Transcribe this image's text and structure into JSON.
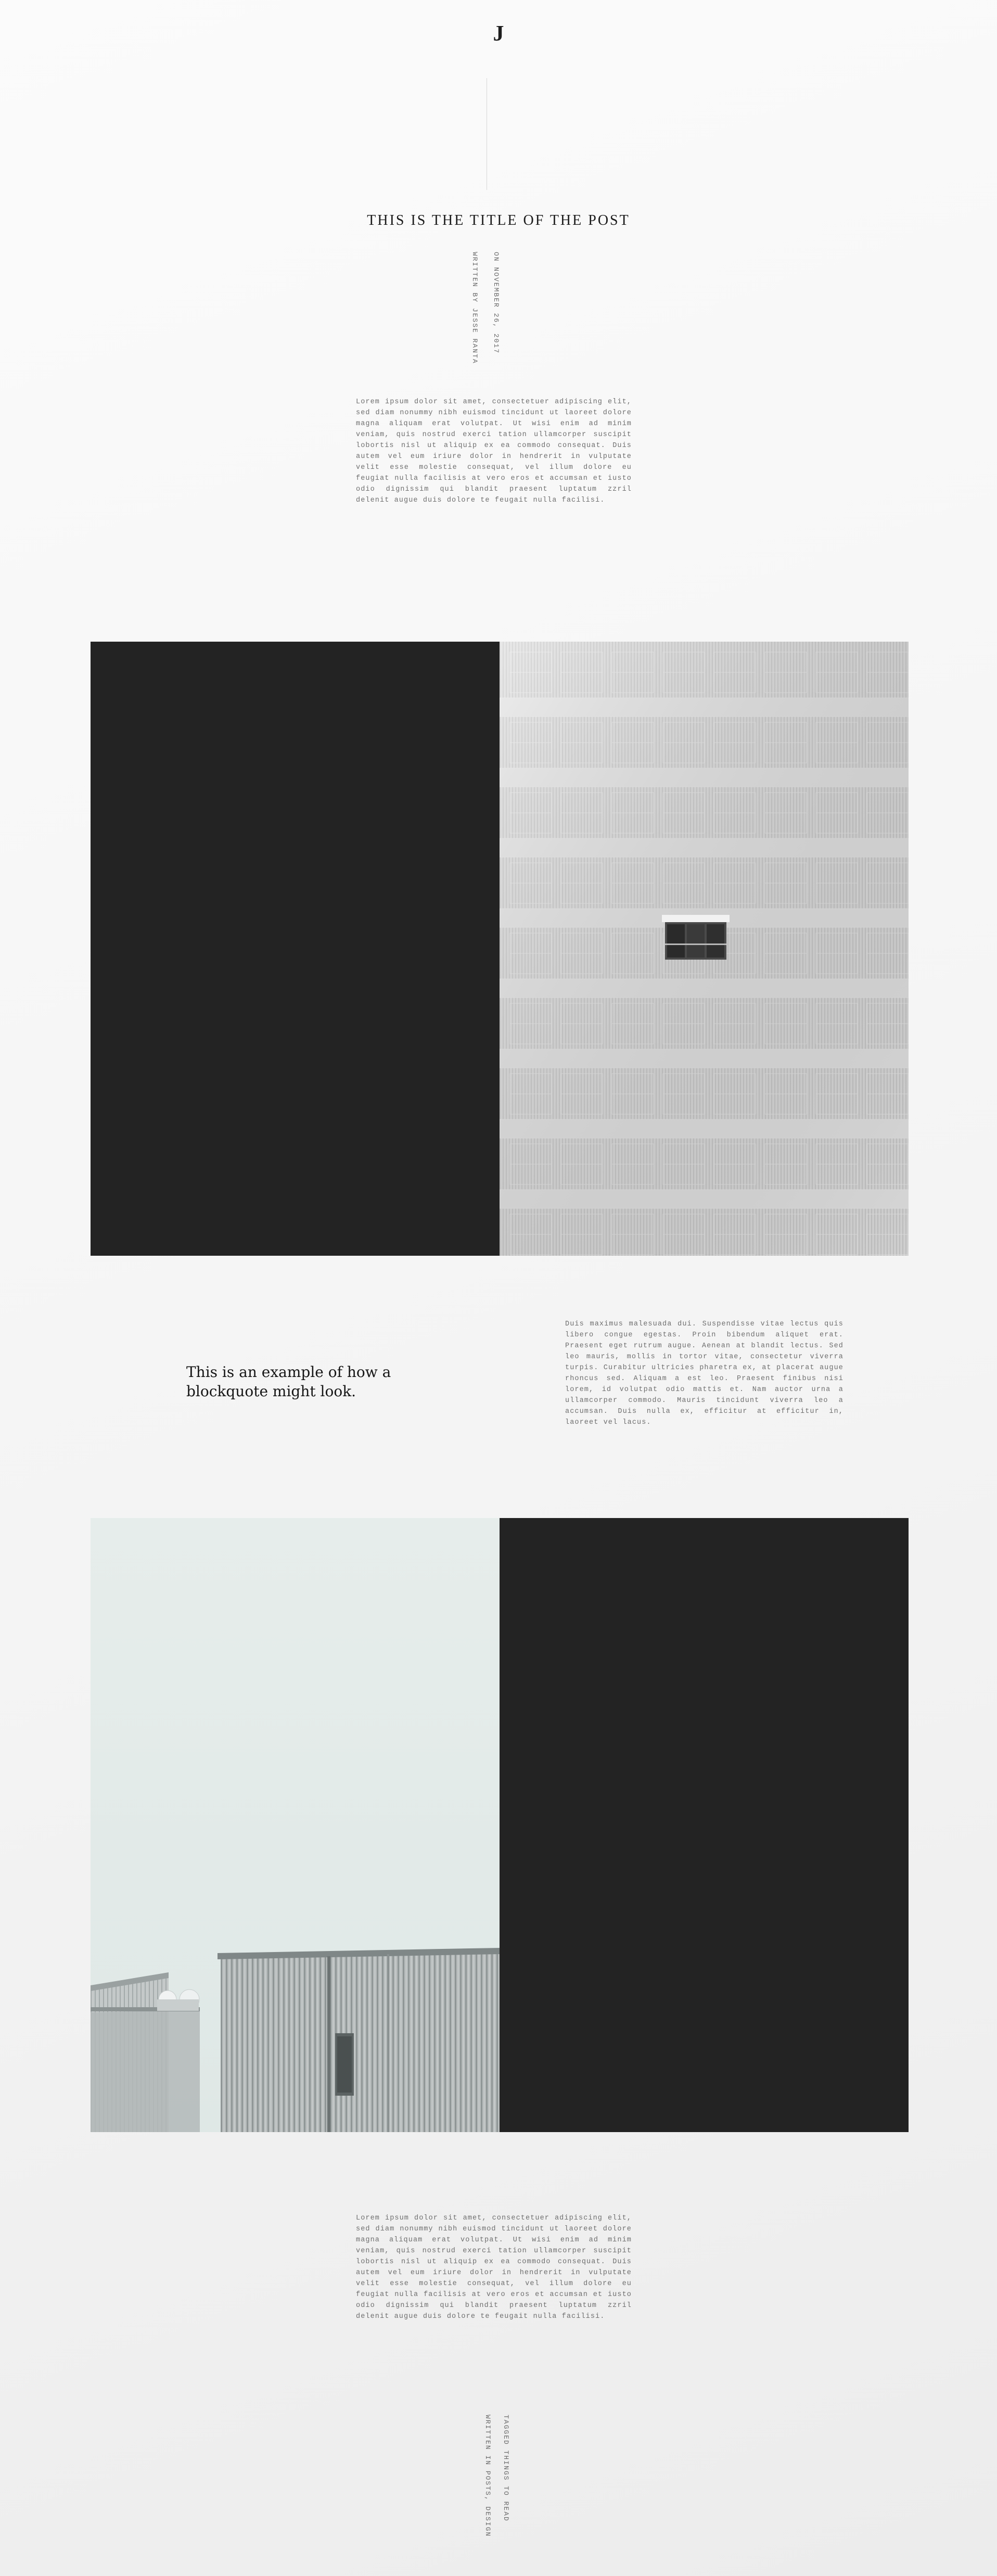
{
  "logo": "J",
  "post": {
    "title": "THIS IS THE TITLE OF THE POST",
    "byline": "WRITTEN BY JESSE RANTA",
    "date": "ON NOVEMBER 26, 2017",
    "body": "Lorem ipsum dolor sit amet, consectetuer adipiscing elit, sed diam nonummy nibh euismod tincidunt ut laoreet dolore magna aliquam erat volutpat. Ut wisi enim ad minim veniam, quis nostrud exerci tation ullamcorper suscipit lobortis nisl ut aliquip ex ea commodo consequat. Duis autem vel eum iriure dolor in hendrerit in vulputate velit esse molestie consequat, vel illum dolore eu feugiat nulla facilisis at vero eros et accumsan et iusto odio dignissim qui blandit praesent luptatum zzril delenit augue duis dolore te feugait nulla facilisi."
  },
  "images": {
    "building_facade": "building-facade-photo",
    "rooftop": "rooftop-structure-photo"
  },
  "quote": {
    "text": "This is an example of how a blockquote might look.",
    "side_text": "Duis maximus malesuada dui. Suspendisse vitae lectus quis libero congue egestas. Proin bibendum aliquet erat. Praesent eget rutrum augue. Aenean at blandit lectus. Sed leo mauris, mollis in tortor vitae, consectetur viverra turpis. Curabitur ultricies pharetra ex, at placerat augue rhoncus sed. Aliquam a est leo. Praesent finibus nisi lorem, id volutpat odio mattis et. Nam auctor urna a ullamcorper commodo. Mauris tincidunt viverra leo a accumsan. Duis nulla ex, efficitur at efficitur in, laoreet vel lacus."
  },
  "closing": {
    "body": "Lorem ipsum dolor sit amet, consectetuer adipiscing elit, sed diam nonummy nibh euismod tincidunt ut laoreet dolore magna aliquam erat volutpat. Ut wisi enim ad minim veniam, quis nostrud exerci tation ullamcorper suscipit lobortis nisl ut aliquip ex ea commodo consequat. Duis autem vel eum iriure dolor in hendrerit in vulputate velit esse molestie consequat, vel illum dolore eu feugiat nulla facilisis at vero eros et accumsan et iusto odio dignissim qui blandit praesent luptatum zzril delenit augue duis dolore te feugait nulla facilisi.",
    "footer_line1": "WRITTEN IN POSTS, DESIGN",
    "footer_line2": "TAGGED THINGS TO READ"
  },
  "colors": {
    "panel_dark": "#232323",
    "text_muted": "#6e6e6e",
    "heading": "#1b1b1b"
  }
}
